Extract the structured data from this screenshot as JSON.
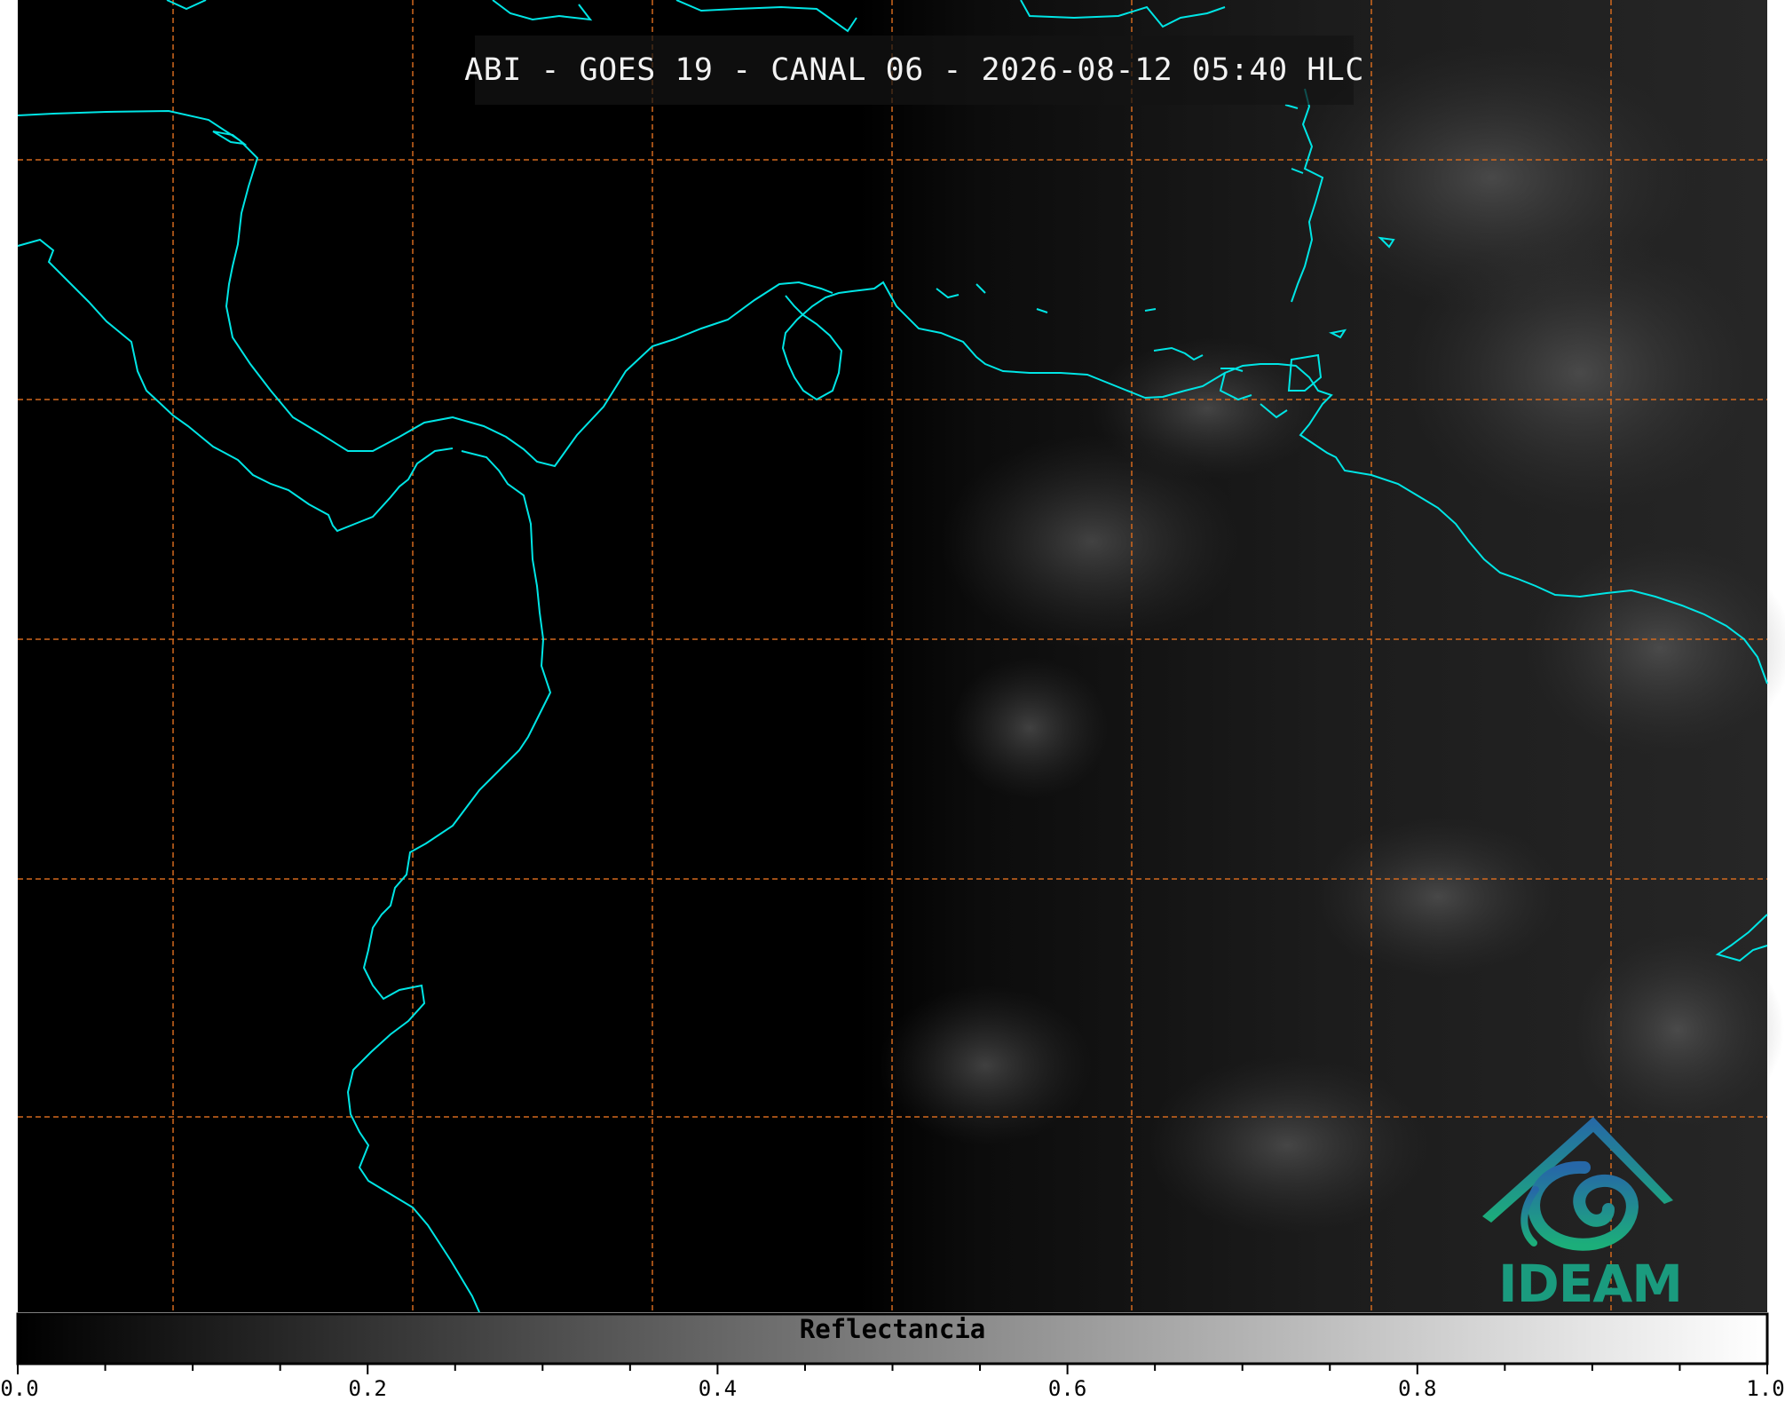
{
  "title": "ABI - GOES 19 - CANAL 06 - 2026-08-12 05:40 HLC",
  "colorbar": {
    "label": "Reflectancia",
    "ticks": [
      "0.0",
      "0.2",
      "0.4",
      "0.6",
      "0.8",
      "1.0"
    ],
    "range": [
      0.0,
      1.0
    ],
    "colormap": [
      "#000000",
      "#ffffff"
    ]
  },
  "logo": {
    "text": "IDEAM",
    "color": "#1a9b7e"
  },
  "colors": {
    "coastline": "#00e5e5",
    "gridlines": "#d2691e",
    "background": "#000000"
  }
}
